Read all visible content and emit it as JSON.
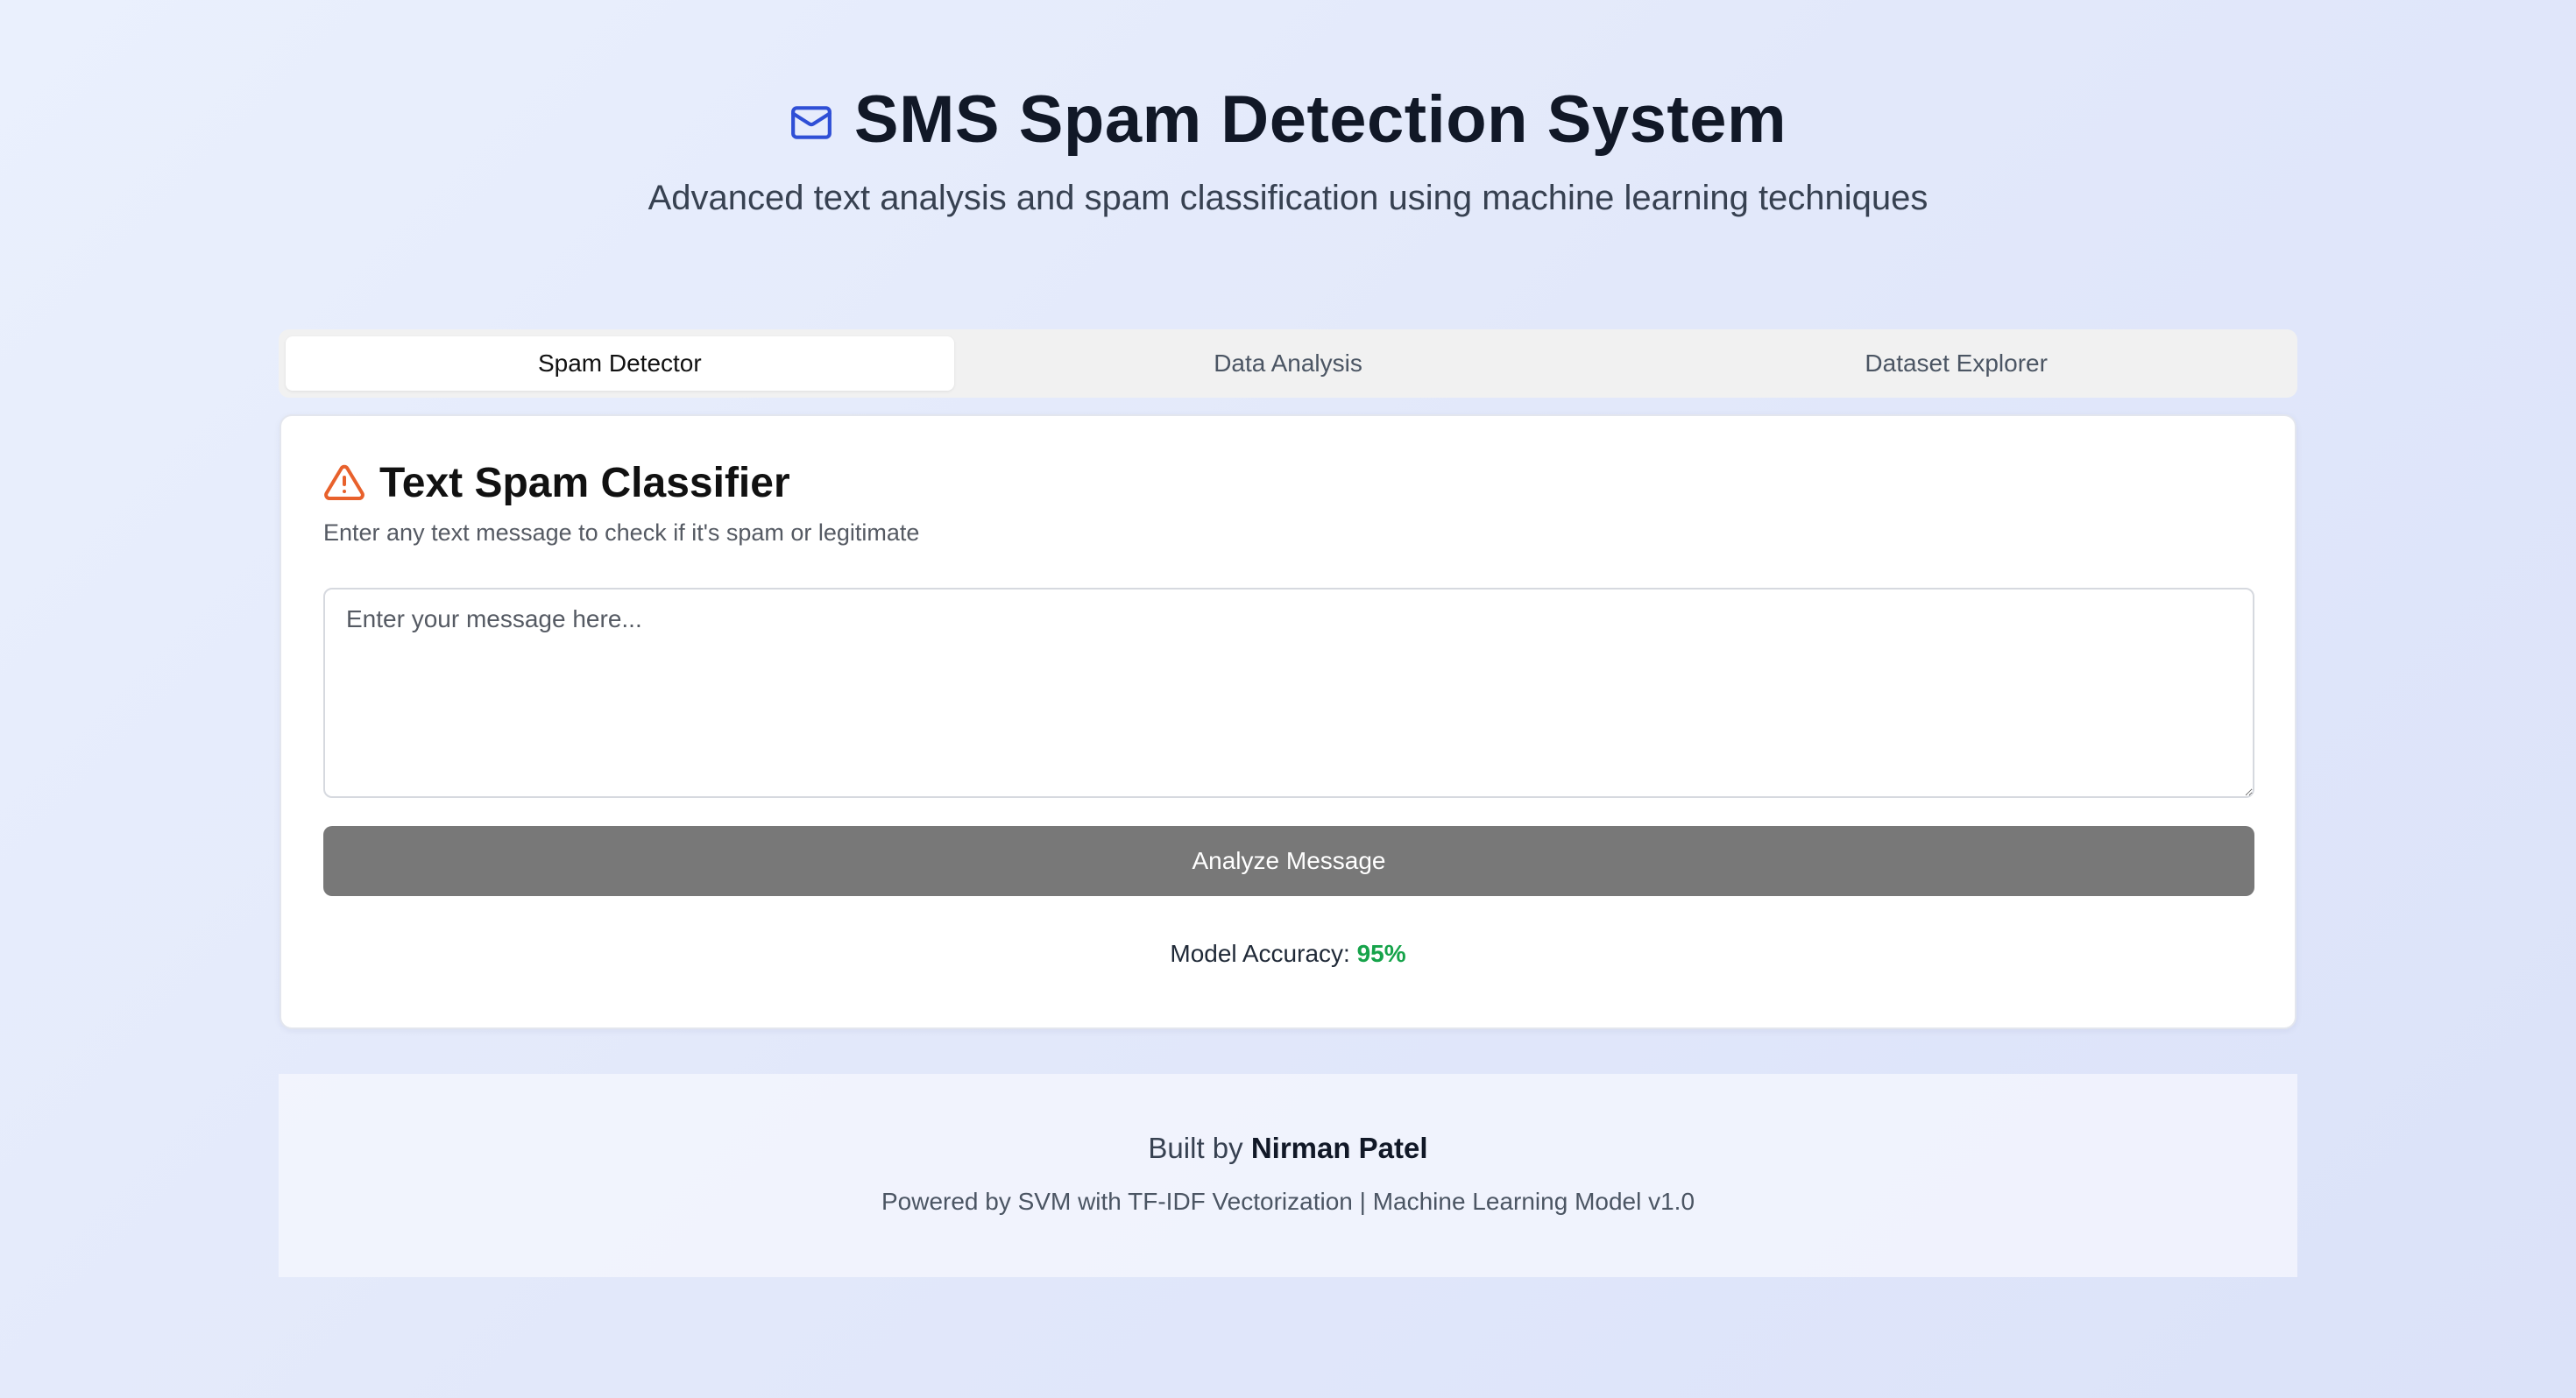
{
  "header": {
    "icon": "mail-icon",
    "title": "SMS Spam Detection System",
    "subtitle": "Advanced text analysis and spam classification using machine learning techniques"
  },
  "tabs": [
    {
      "label": "Spam Detector",
      "active": true
    },
    {
      "label": "Data Analysis",
      "active": false
    },
    {
      "label": "Dataset Explorer",
      "active": false
    }
  ],
  "classifier": {
    "icon": "warning-triangle-icon",
    "title": "Text Spam Classifier",
    "description": "Enter any text message to check if it's spam or legitimate",
    "input_placeholder": "Enter your message here...",
    "input_value": "",
    "button_label": "Analyze Message",
    "accuracy_label": "Model Accuracy:",
    "accuracy_value": "95%"
  },
  "footer": {
    "built_by_prefix": "Built by",
    "author": "Nirman Patel",
    "powered_by": "Powered by SVM with TF-IDF Vectorization | Machine Learning Model v1.0"
  },
  "colors": {
    "accent_icon": "#2f4fd6",
    "warning_icon": "#e8612c",
    "accuracy": "#16a34a",
    "button": "#787878"
  }
}
